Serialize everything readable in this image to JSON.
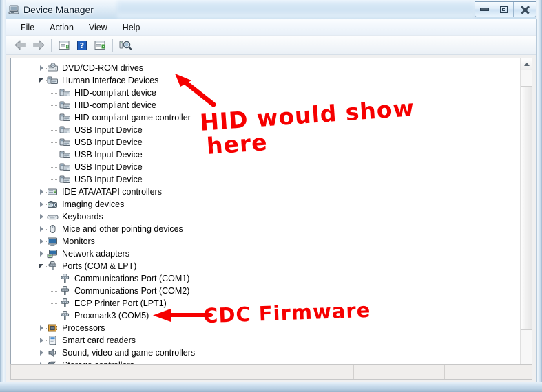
{
  "window": {
    "title": "Device Manager",
    "icon": "device-manager-icon",
    "controls": {
      "minimize": "Minimize",
      "maximize": "Maximize",
      "close": "Close"
    }
  },
  "menubar": {
    "items": [
      {
        "label": "File",
        "name": "menu-file"
      },
      {
        "label": "Action",
        "name": "menu-action"
      },
      {
        "label": "View",
        "name": "menu-view"
      },
      {
        "label": "Help",
        "name": "menu-help"
      }
    ]
  },
  "toolbar": {
    "buttons": [
      {
        "name": "back-button",
        "icon": "back-arrow-icon"
      },
      {
        "name": "forward-button",
        "icon": "forward-arrow-icon"
      },
      {
        "name": "properties-button",
        "icon": "properties-icon"
      },
      {
        "name": "help-button",
        "icon": "question-mark-icon"
      },
      {
        "name": "update-driver-button",
        "icon": "update-driver-icon"
      },
      {
        "name": "scan-hardware-button",
        "icon": "scan-hardware-icon"
      }
    ]
  },
  "tree": {
    "nodes": [
      {
        "label": "DVD/CD-ROM drives",
        "level": 1,
        "state": "collapsed",
        "icon": "dvd-drive-icon"
      },
      {
        "label": "Human Interface Devices",
        "level": 1,
        "state": "expanded",
        "icon": "hid-icon"
      },
      {
        "label": "HID-compliant device",
        "level": 2,
        "state": "leaf",
        "icon": "hid-icon"
      },
      {
        "label": "HID-compliant device",
        "level": 2,
        "state": "leaf",
        "icon": "hid-icon"
      },
      {
        "label": "HID-compliant game controller",
        "level": 2,
        "state": "leaf",
        "icon": "hid-icon"
      },
      {
        "label": "USB Input Device",
        "level": 2,
        "state": "leaf",
        "icon": "hid-icon"
      },
      {
        "label": "USB Input Device",
        "level": 2,
        "state": "leaf",
        "icon": "hid-icon"
      },
      {
        "label": "USB Input Device",
        "level": 2,
        "state": "leaf",
        "icon": "hid-icon"
      },
      {
        "label": "USB Input Device",
        "level": 2,
        "state": "leaf",
        "icon": "hid-icon"
      },
      {
        "label": "USB Input Device",
        "level": 2,
        "state": "leaf",
        "icon": "hid-icon"
      },
      {
        "label": "IDE ATA/ATAPI controllers",
        "level": 1,
        "state": "collapsed",
        "icon": "ide-controller-icon"
      },
      {
        "label": "Imaging devices",
        "level": 1,
        "state": "collapsed",
        "icon": "camera-icon"
      },
      {
        "label": "Keyboards",
        "level": 1,
        "state": "collapsed",
        "icon": "keyboard-icon"
      },
      {
        "label": "Mice and other pointing devices",
        "level": 1,
        "state": "collapsed",
        "icon": "mouse-icon"
      },
      {
        "label": "Monitors",
        "level": 1,
        "state": "collapsed",
        "icon": "monitor-icon"
      },
      {
        "label": "Network adapters",
        "level": 1,
        "state": "collapsed",
        "icon": "network-adapter-icon"
      },
      {
        "label": "Ports (COM & LPT)",
        "level": 1,
        "state": "expanded",
        "icon": "port-icon"
      },
      {
        "label": "Communications Port (COM1)",
        "level": 2,
        "state": "leaf",
        "icon": "port-icon"
      },
      {
        "label": "Communications Port (COM2)",
        "level": 2,
        "state": "leaf",
        "icon": "port-icon"
      },
      {
        "label": "ECP Printer Port (LPT1)",
        "level": 2,
        "state": "leaf",
        "icon": "port-icon"
      },
      {
        "label": "Proxmark3 (COM5)",
        "level": 2,
        "state": "leaf",
        "icon": "port-icon"
      },
      {
        "label": "Processors",
        "level": 1,
        "state": "collapsed",
        "icon": "processor-icon"
      },
      {
        "label": "Smart card readers",
        "level": 1,
        "state": "collapsed",
        "icon": "smartcard-icon"
      },
      {
        "label": "Sound, video and game controllers",
        "level": 1,
        "state": "collapsed",
        "icon": "speaker-icon"
      },
      {
        "label": "Storage controllers",
        "level": 1,
        "state": "collapsed",
        "icon": "storage-controller-icon"
      }
    ]
  },
  "scrollbar": {
    "up_arrow": "scroll-up-arrow",
    "down_arrow": "scroll-down-arrow",
    "thumb": "scroll-thumb"
  },
  "statusbar": {
    "text": "",
    "cell2": "",
    "cell3": ""
  },
  "annotations": {
    "color": "#f60000",
    "hid": {
      "line1": "HID would show",
      "line2": "here",
      "arrow": "arrow-up-left"
    },
    "cdc": {
      "line1": "CDC Firmware",
      "arrow": "arrow-left"
    }
  }
}
